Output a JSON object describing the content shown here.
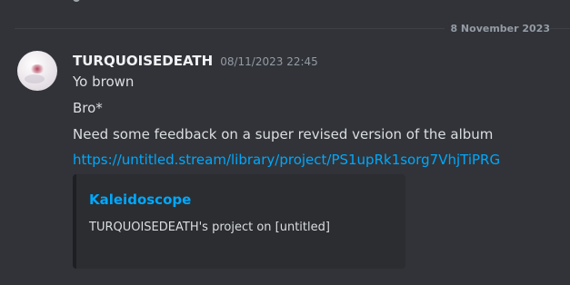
{
  "date_divider": "8 November 2023",
  "message": {
    "author": "TURQUOISEDEATH",
    "timestamp": "08/11/2023 22:45",
    "lines": [
      "Yo brown",
      "Bro*",
      "Need some feedback on a super revised version of the album"
    ],
    "link": "https://untitled.stream/library/project/PS1upRk1sorg7VhjTiPRG"
  },
  "embed": {
    "title": "Kaleidoscope",
    "description": "TURQUOISEDEATH's project on [untitled]"
  },
  "colors": {
    "background": "#313338",
    "link": "#00a8fc",
    "embed_background": "#2b2d31"
  }
}
